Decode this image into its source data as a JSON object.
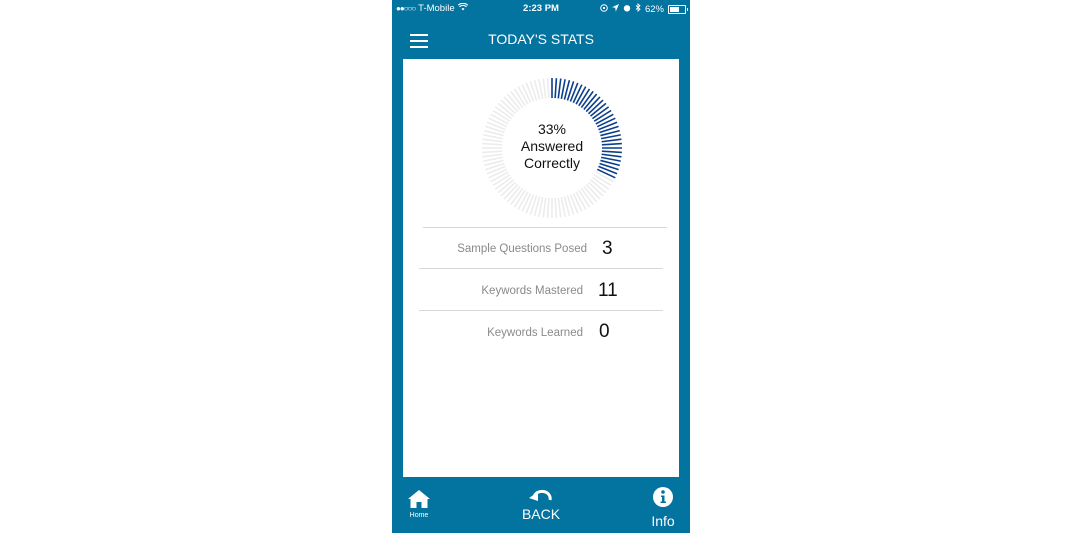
{
  "status_bar": {
    "signal": "●●○○○",
    "carrier": "T-Mobile",
    "time": "2:23 PM",
    "battery_percent": "62%",
    "battery_level": 0.62
  },
  "header": {
    "title": "TODAY'S STATS",
    "menu_icon": "hamburger-icon"
  },
  "progress_ring": {
    "percent_correct": 33,
    "line1": "33%",
    "line2": "Answered",
    "line3": "Correctly",
    "active_color": "#0b3f8c",
    "inactive_color": "#ececec"
  },
  "stats": [
    {
      "label": "Sample Questions Posed",
      "value": "3"
    },
    {
      "label": "Keywords Mastered",
      "value": "11"
    },
    {
      "label": "Keywords Learned",
      "value": "0"
    }
  ],
  "footer": {
    "home_label": "Home",
    "back_label": "BACK",
    "info_label": "Info"
  },
  "colors": {
    "brand": "#03739f",
    "card": "#ffffff"
  }
}
